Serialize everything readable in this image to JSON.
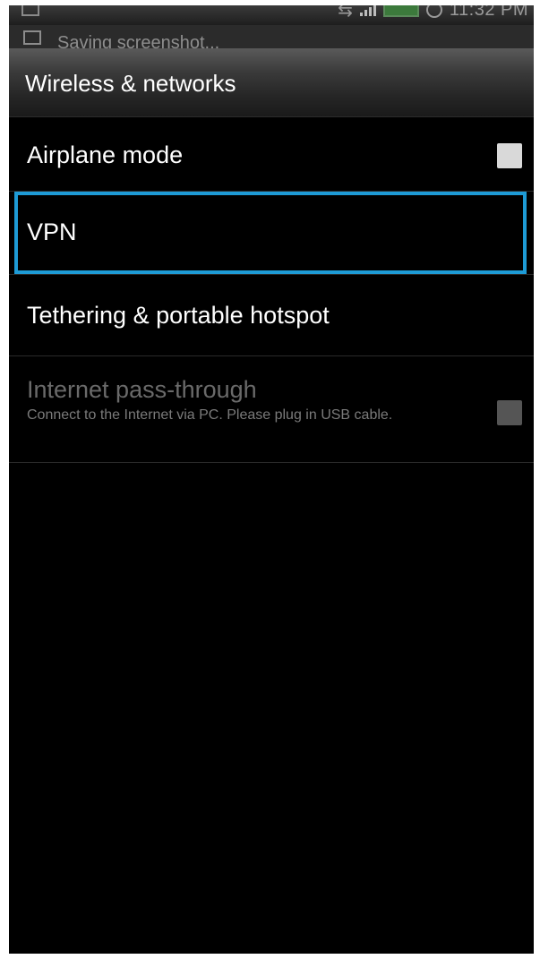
{
  "status_bar": {
    "time": "11:32 PM",
    "left_icon": "screenshot-icon",
    "icons": [
      "usb-icon",
      "signal-icon",
      "battery-icon",
      "alarm-icon"
    ]
  },
  "notification": {
    "icon": "image-icon",
    "text": "Saving screenshot..."
  },
  "header": {
    "title": "Wireless & networks"
  },
  "settings": {
    "airplane_mode": {
      "label": "Airplane mode",
      "checked": false
    },
    "vpn": {
      "label": "VPN",
      "highlight_color": "#1e9bd6"
    },
    "tethering": {
      "label": "Tethering & portable hotspot"
    },
    "internet_pass_through": {
      "label": "Internet pass-through",
      "summary": "Connect to the Internet via PC. Please plug in USB cable.",
      "enabled": false,
      "checked": false
    }
  }
}
